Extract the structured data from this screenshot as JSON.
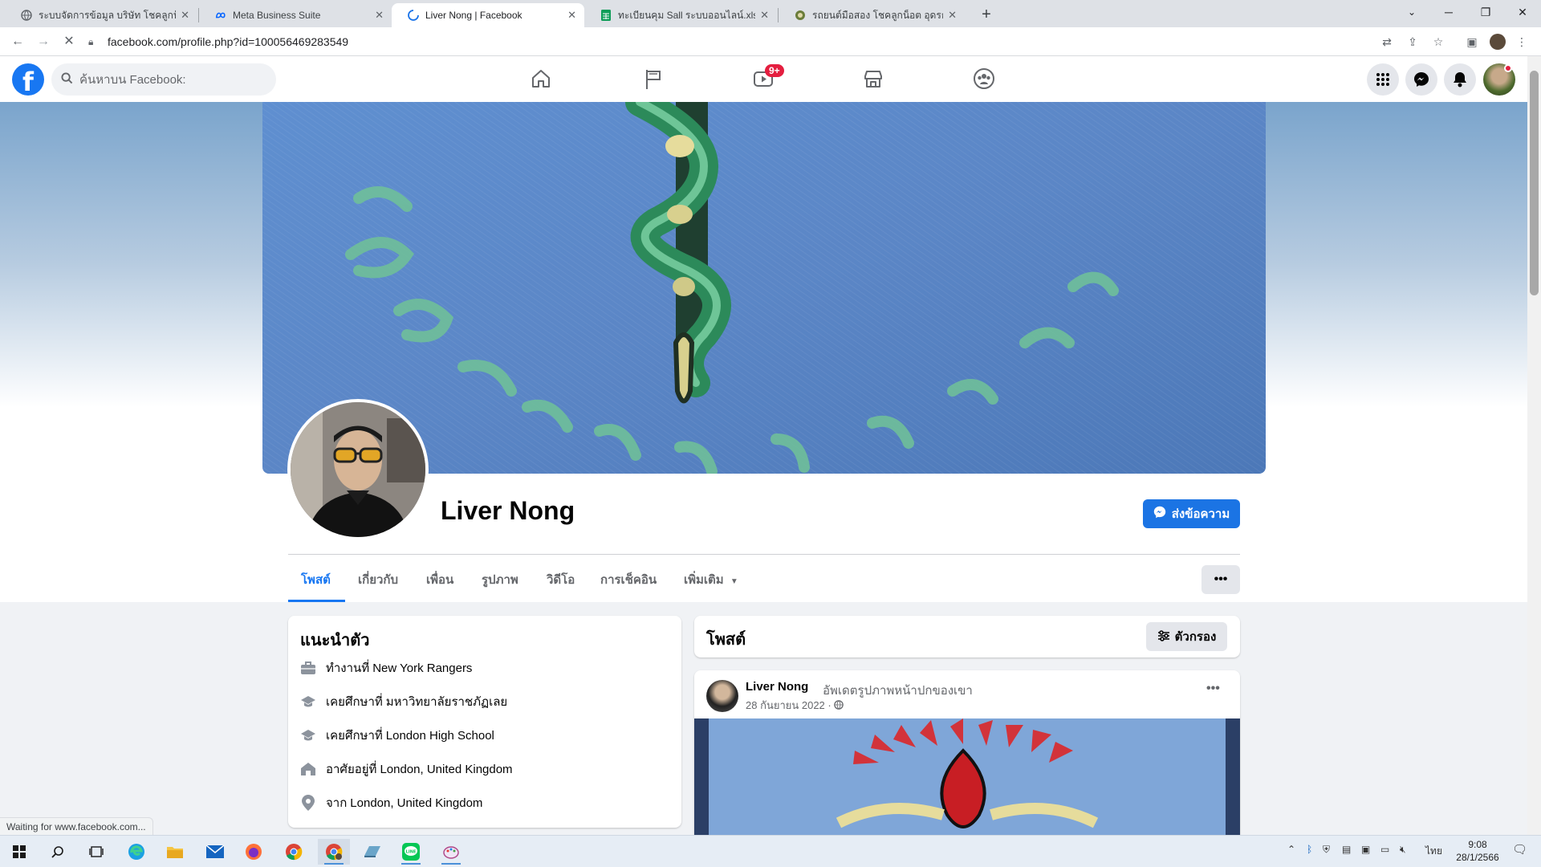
{
  "browser": {
    "tabs": [
      {
        "title": "ระบบจัดการข้อมูล บริษัท โชคลูกน็อต จำกัด",
        "favicon": "globe-icon",
        "active": false
      },
      {
        "title": "Meta Business Suite",
        "favicon": "meta-icon",
        "active": false
      },
      {
        "title": "Liver Nong | Facebook",
        "favicon": "loading-icon",
        "active": true
      },
      {
        "title": "ทะเบียนคุม Sall ระบบออนไลน์.xlsx - Google ชีต",
        "favicon": "sheets-icon",
        "active": false
      },
      {
        "title": "รถยนต์มือสอง โชคลูกน็อต อุดรธานี",
        "favicon": "site-icon",
        "active": false
      }
    ],
    "url": "facebook.com/profile.php?id=100056469283549",
    "status_text": "Waiting for www.facebook.com..."
  },
  "fb_header": {
    "logo": "f",
    "search_placeholder": "ค้นหาบน Facebook:",
    "nav": [
      {
        "name": "home-icon"
      },
      {
        "name": "pages-flag-icon"
      },
      {
        "name": "watch-video-icon",
        "badge": "9+"
      },
      {
        "name": "marketplace-icon"
      },
      {
        "name": "groups-icon"
      }
    ],
    "right_icons": [
      "menu-grid-icon",
      "messenger-icon",
      "notifications-bell-icon",
      "account-avatar"
    ]
  },
  "profile": {
    "name": "Liver Nong",
    "message_button": "ส่งข้อความ",
    "tabs": [
      "โพสต์",
      "เกี่ยวกับ",
      "เพื่อน",
      "รูปภาพ",
      "วิดีโอ",
      "การเช็คอิน",
      "เพิ่มเติม"
    ],
    "active_tab": "โพสต์",
    "more_button": "•••"
  },
  "intro": {
    "title": "แนะนำตัว",
    "items": [
      {
        "icon": "briefcase-icon",
        "prefix": "ทำงานที่",
        "value": "New York Rangers"
      },
      {
        "icon": "graduation-cap-icon",
        "prefix": "เคยศึกษาที่",
        "value": "มหาวิทยาลัยราชภัฏเลย"
      },
      {
        "icon": "graduation-cap-icon",
        "prefix": "เคยศึกษาที่",
        "value": "London High School"
      },
      {
        "icon": "house-icon",
        "prefix": "อาศัยอยู่ที่",
        "value": "London, United Kingdom"
      },
      {
        "icon": "location-pin-icon",
        "prefix": "จาก",
        "value": "London, United Kingdom"
      }
    ]
  },
  "posts": {
    "title": "โพสต์",
    "filter_label": "ตัวกรอง",
    "post": {
      "author": "Liver Nong",
      "action": "อัพเดตรูปภาพหน้าปกของเขา",
      "date": "28 กันยายน 2022 ·",
      "privacy_icon": "globe-icon",
      "more": "•••"
    }
  },
  "taskbar": {
    "apps": [
      "windows-start-icon",
      "search-icon",
      "task-view-icon",
      "edge-icon",
      "file-explorer-icon",
      "mail-icon",
      "firefox-icon",
      "chrome-icon",
      "chrome-profile-icon",
      "app-icon",
      "line-icon",
      "paint-icon"
    ],
    "language": "ไทย",
    "time": "9:08",
    "date": "28/1/2566"
  },
  "colors": {
    "fb_blue": "#1877f2",
    "button_blue": "#1b74e4",
    "badge_red": "#e41e3f",
    "page_bg": "#f0f2f5"
  }
}
